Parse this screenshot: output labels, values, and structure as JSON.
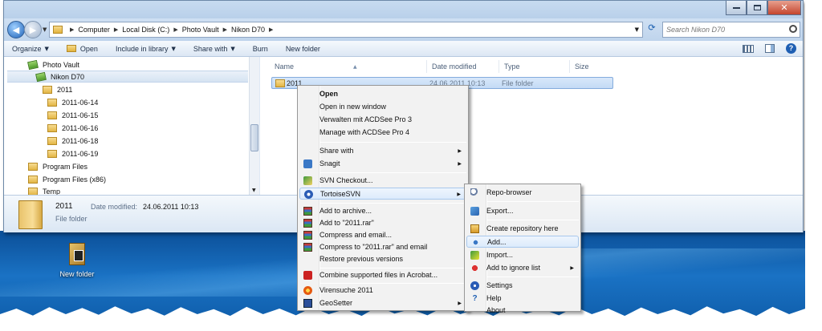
{
  "window": {
    "controls": {
      "minimize": "minimize",
      "maximize": "maximize",
      "close": "✕"
    }
  },
  "address": {
    "path": [
      "Computer",
      "Local Disk (C:)",
      "Photo Vault",
      "Nikon D70"
    ],
    "search_placeholder": "Search Nikon D70"
  },
  "toolbar": {
    "organize": "Organize",
    "open": "Open",
    "include_in_library": "Include in library",
    "share_with": "Share with",
    "burn": "Burn",
    "new_folder": "New folder"
  },
  "tree": [
    {
      "label": "Photo Vault",
      "icon": "library-folder-icon"
    },
    {
      "label": "Nikon D70",
      "icon": "library-folder-icon",
      "selected": true
    },
    {
      "label": "2011",
      "icon": "folder-icon"
    },
    {
      "label": "2011-06-14",
      "icon": "folder-icon"
    },
    {
      "label": "2011-06-15",
      "icon": "folder-icon"
    },
    {
      "label": "2011-06-16",
      "icon": "folder-icon"
    },
    {
      "label": "2011-06-18",
      "icon": "folder-icon"
    },
    {
      "label": "2011-06-19",
      "icon": "folder-icon"
    },
    {
      "label": "Program Files",
      "icon": "folder-icon"
    },
    {
      "label": "Program Files (x86)",
      "icon": "folder-icon"
    },
    {
      "label": "Temp",
      "icon": "folder-icon"
    }
  ],
  "columns": {
    "name": "Name",
    "date_modified": "Date modified",
    "type": "Type",
    "size": "Size"
  },
  "files": [
    {
      "name": "2011",
      "date_modified": "24.06.2011 10:13",
      "type": "File folder"
    }
  ],
  "details": {
    "name": "2011",
    "date_label": "Date modified:",
    "date_value": "24.06.2011 10:13",
    "type": "File folder"
  },
  "desktop": {
    "icon_label": "New folder"
  },
  "context_menu": {
    "open": "Open",
    "open_new_window": "Open in new window",
    "acdsee3": "Verwalten mit ACDSee Pro 3",
    "acdsee4": "Manage with ACDSee Pro 4",
    "share_with": "Share with",
    "snagit": "Snagit",
    "svn_checkout": "SVN Checkout...",
    "tortoisesvn": "TortoiseSVN",
    "add_archive": "Add to archive...",
    "add_rar": "Add to \"2011.rar\"",
    "compress_email": "Compress and email...",
    "compress_rar_email": "Compress to \"2011.rar\" and email",
    "restore_versions": "Restore previous versions",
    "combine_acrobat": "Combine supported files in Acrobat...",
    "virensuche": "Virensuche 2011",
    "geosetter": "GeoSetter"
  },
  "svn_menu": {
    "repo_browser": "Repo-browser",
    "export": "Export...",
    "create_repo": "Create repository here",
    "add": "Add...",
    "import": "Import...",
    "ignore": "Add to ignore list",
    "settings": "Settings",
    "help": "Help",
    "about": "About"
  }
}
